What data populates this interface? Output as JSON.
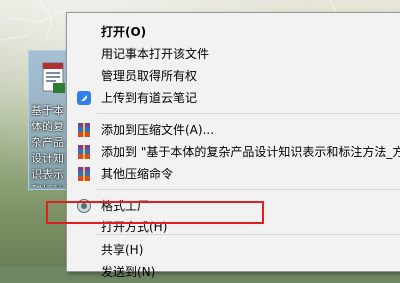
{
  "desktop": {
    "icon_label": "基于本体的复杂产品设计知识表示和标注方法_方伟光"
  },
  "context_menu": {
    "items": [
      {
        "label": "打开(O)",
        "bold": true,
        "icon": ""
      },
      {
        "label": "用记事本打开该文件",
        "icon": ""
      },
      {
        "label": "管理员取得所有权",
        "icon": ""
      },
      {
        "label": "上传到有道云笔记",
        "icon": "youdao-note-icon"
      },
      {
        "label": "添加到压缩文件(A)...",
        "icon": "winrar-archive-icon"
      },
      {
        "label": "添加到 \"基于本体的复杂产品设计知识表示和标注方法_方伟",
        "icon": "winrar-archive-icon"
      },
      {
        "label": "其他压缩命令",
        "icon": "winrar-archive-icon"
      },
      {
        "label": "格式工厂",
        "icon": "format-factory-icon"
      },
      {
        "label": "打开方式(H)",
        "icon": ""
      },
      {
        "label": "共享(H)",
        "icon": ""
      },
      {
        "label": "发送到(N)",
        "icon": ""
      }
    ]
  },
  "colors": {
    "highlight_border": "#e02020",
    "youdao": "#2f80ed",
    "menu_bg": "#f2f2f2"
  }
}
